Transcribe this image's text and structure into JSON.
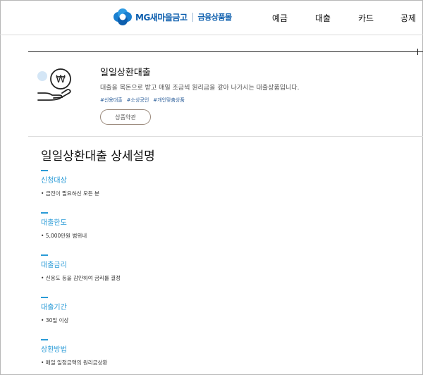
{
  "brand": {
    "name": "MG새마을금고",
    "sub": "금융상품몰",
    "accent": "#0e5fae"
  },
  "nav": [
    "예금",
    "대출",
    "카드",
    "공제"
  ],
  "product": {
    "icon": "hand-coin-icon",
    "title": "일일상환대출",
    "description": "대출을 목돈으로 받고 매일 조금씩 원리금을 갚아 나가시는 대출상품입니다.",
    "tags": [
      "#신용대출",
      "#소상공인",
      "#개인맞춤상품"
    ],
    "terms_button": "상품약관"
  },
  "details": {
    "title": "일일상환대출 상세설명",
    "sections": [
      {
        "heading": "신청대상",
        "item": "• 급전이 필요하신 모든 분"
      },
      {
        "heading": "대출한도",
        "item": "• 5,000만원 범위내"
      },
      {
        "heading": "대출금리",
        "item": "• 신용도 등을 감안하여 금리를 결정"
      },
      {
        "heading": "대출기간",
        "item": "• 30일 이상"
      },
      {
        "heading": "상환방법",
        "item": "• 매일 일정금액의 원리금상환"
      }
    ]
  }
}
